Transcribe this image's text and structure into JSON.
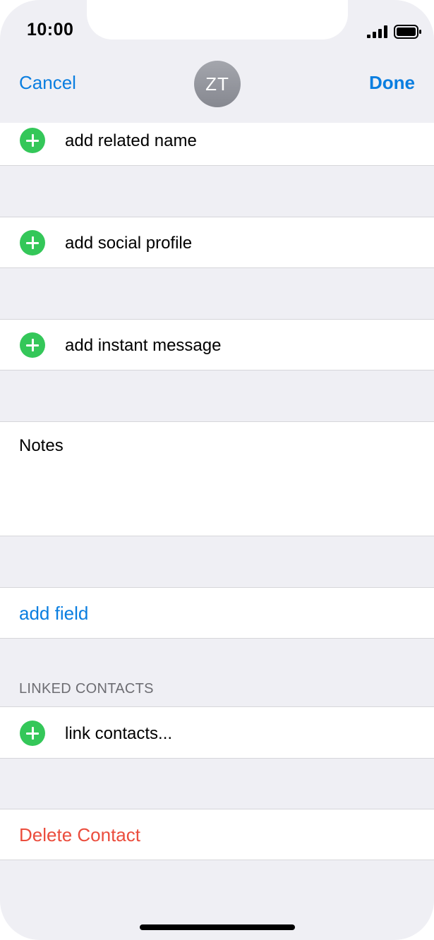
{
  "status_bar": {
    "time": "10:00",
    "signal_icon": "cellular-signal-icon",
    "battery_icon": "battery-full-icon"
  },
  "nav": {
    "cancel_label": "Cancel",
    "avatar_initials": "ZT",
    "done_label": "Done"
  },
  "rows": {
    "related_name": "add related name",
    "social_profile": "add social profile",
    "instant_message": "add instant message",
    "notes_label": "Notes",
    "add_field": "add field",
    "link_contacts": "link contacts...",
    "delete_contact": "Delete Contact"
  },
  "sections": {
    "linked_contacts_header": "LINKED CONTACTS"
  },
  "colors": {
    "accent": "#0a7ee0",
    "add_green": "#34c759",
    "destructive": "#eb4d3d",
    "grouped_background": "#efeff4"
  },
  "icons": {
    "add": "plus-circle-icon"
  }
}
